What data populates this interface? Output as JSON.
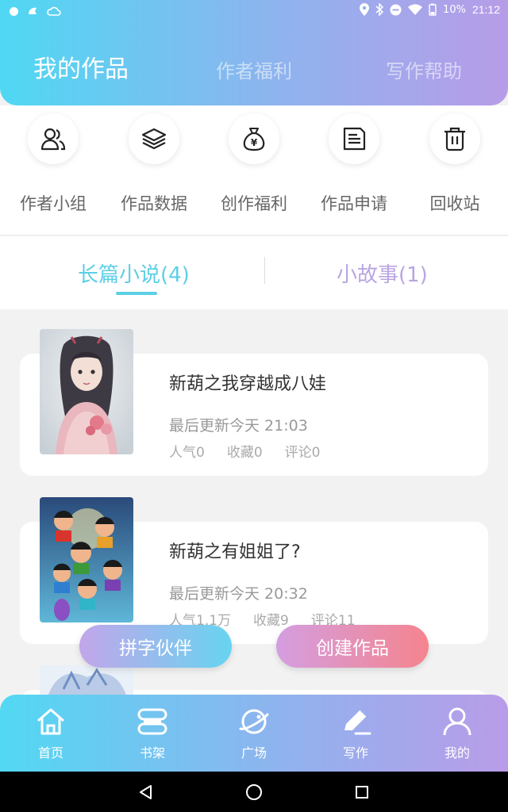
{
  "status_bar": {
    "battery": "10%",
    "time": "21:12"
  },
  "header": {
    "tabs": [
      {
        "label": "我的作品",
        "active": true
      },
      {
        "label": "作者福利",
        "active": false
      },
      {
        "label": "写作帮助",
        "active": false
      }
    ]
  },
  "quick_actions": [
    {
      "label": "作者小组",
      "icon": "users-icon"
    },
    {
      "label": "作品数据",
      "icon": "layers-icon"
    },
    {
      "label": "创作福利",
      "icon": "money-bag-icon"
    },
    {
      "label": "作品申请",
      "icon": "document-icon"
    },
    {
      "label": "回收站",
      "icon": "trash-icon"
    }
  ],
  "sub_tabs": [
    {
      "label": "长篇小说(4)",
      "active": true
    },
    {
      "label": "小故事(1)",
      "active": false
    }
  ],
  "works": [
    {
      "title": "新葫之我穿越成八娃",
      "updated": "最后更新今天 21:03",
      "stats": [
        "人气0",
        "收藏0",
        "评论0"
      ]
    },
    {
      "title": "新葫之有姐姐了?",
      "updated": "最后更新今天 20:32",
      "stats": [
        "人气1.1万",
        "收藏9",
        "评论11"
      ]
    }
  ],
  "floating_buttons": {
    "left": "拼字伙伴",
    "right": "创建作品"
  },
  "bottom_nav": [
    {
      "label": "首页",
      "icon": "home-icon"
    },
    {
      "label": "书架",
      "icon": "bookshelf-icon"
    },
    {
      "label": "广场",
      "icon": "planet-icon"
    },
    {
      "label": "写作",
      "icon": "pen-icon",
      "active": true
    },
    {
      "label": "我的",
      "icon": "user-icon"
    }
  ],
  "colors": {
    "accent_cyan": "#5ccfe6",
    "accent_purple": "#b9a5e2",
    "header_gradient_start": "#4fd8f3",
    "header_gradient_end": "#b79ce8"
  }
}
